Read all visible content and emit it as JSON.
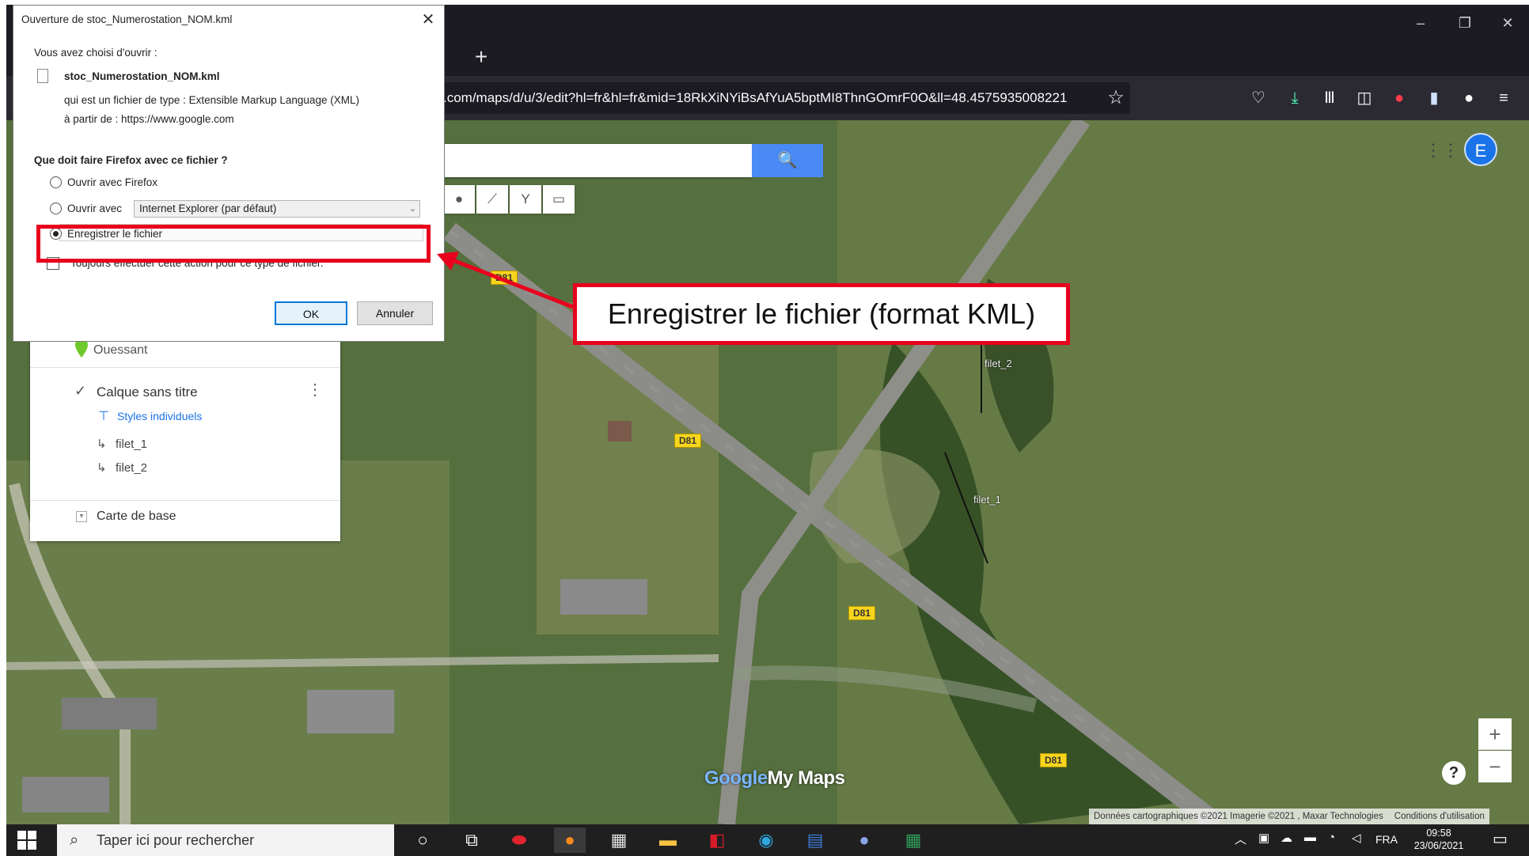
{
  "browser": {
    "new_tab_label": "+",
    "url": ".com/maps/d/u/3/edit?hl=fr&hl=fr&mid=18RkXiNYiBsAfYuA5bptMI8ThnGOmrF0O&ll=48.4575935008221",
    "window_controls": [
      "–",
      "❐",
      "✕"
    ]
  },
  "map": {
    "title": "Ouessant",
    "layer": {
      "name": "Calque sans titre",
      "style_link": "Styles individuels",
      "features": [
        "filet_1",
        "filet_2"
      ],
      "menu_glyph": "⋮"
    },
    "basemap_label": "Carte de base",
    "road_labels": [
      "D81",
      "D81",
      "D81",
      "D81"
    ],
    "line_labels": [
      "filet_2",
      "filet_1"
    ],
    "logo_google": "Google",
    "logo_mymaps": "My Maps",
    "zoom_in": "+",
    "zoom_out": "−",
    "help": "?",
    "attribution": "Données cartographiques ©2021 Imagerie ©2021 , Maxar Technologies",
    "terms": "Conditions d'utilisation",
    "account_initial": "E"
  },
  "dialog": {
    "title": "Ouverture de stoc_Numerostation_NOM.kml",
    "close": "✕",
    "intro": "Vous avez choisi d'ouvrir :",
    "filename": "stoc_Numerostation_NOM.kml",
    "file_type": "qui est un fichier de type : Extensible Markup Language (XML)",
    "source": "à partir de : https://www.google.com",
    "question": "Que doit faire Firefox avec ce fichier ?",
    "option_open_firefox": "Ouvrir avec Firefox",
    "option_open_with": "Ouvrir avec",
    "open_with_app": "Internet Explorer (par défaut)",
    "option_save": "Enregistrer le fichier",
    "always_label": "Toujours effectuer cette action pour ce type de fichier.",
    "ok_label": "OK",
    "cancel_label": "Annuler"
  },
  "annotation": {
    "callout": "Enregistrer le fichier (format KML)",
    "color": "#e8001d"
  },
  "taskbar": {
    "search_placeholder": "Taper ici pour rechercher",
    "language": "FRA",
    "time": "09:58",
    "date": "23/06/2021"
  }
}
